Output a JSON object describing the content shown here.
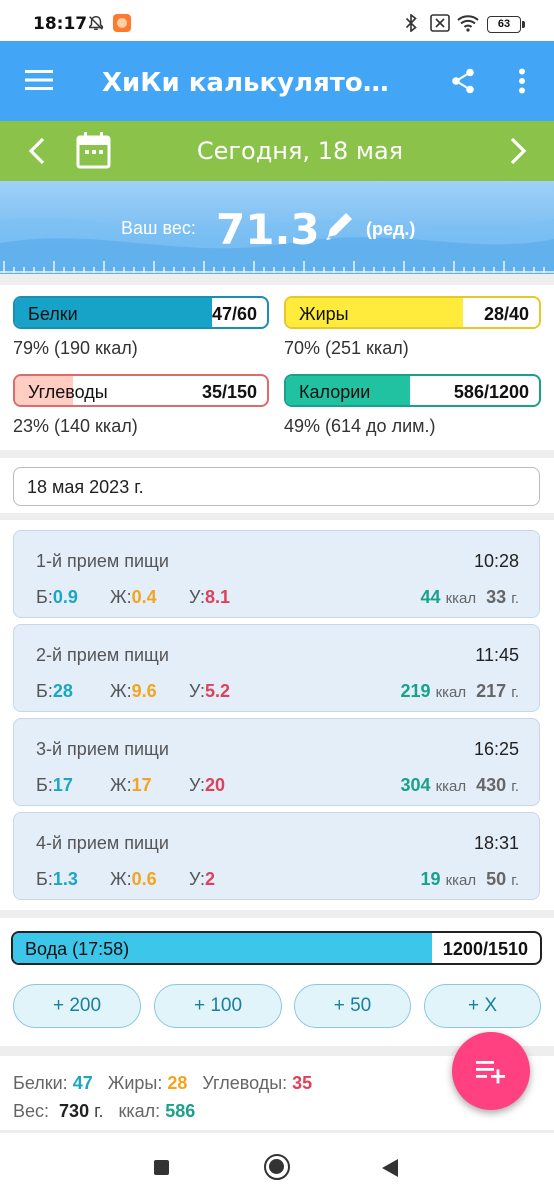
{
  "status_bar": {
    "time": "18:17",
    "battery": "63",
    "icons": [
      "notifications-off-icon",
      "app-notification-icon",
      "bluetooth-icon",
      "sim-off-icon",
      "wifi-icon",
      "battery-icon"
    ]
  },
  "app_bar": {
    "title": "ХиКи калькулятор калорий",
    "icons": [
      "menu-icon",
      "share-icon",
      "more-vert-icon"
    ]
  },
  "date_nav": {
    "date": "Сегодня, 18 мая",
    "icons": [
      "chevron-left-icon",
      "calendar-icon",
      "chevron-right-icon"
    ]
  },
  "weight": {
    "label": "Ваш вес:",
    "value": "71.3",
    "edit_label": "(ред.)",
    "icon": "pencil-icon"
  },
  "macros": {
    "protein": {
      "label": "Белки",
      "value": "47/60",
      "fraction": 0.78,
      "note": "79% (190 ккал)",
      "color": "#17a3c8"
    },
    "fat": {
      "label": "Жиры",
      "value": "28/40",
      "fraction": 0.7,
      "note": "70% (251 ккал)",
      "color": "#ffeb3b"
    },
    "carbs": {
      "label": "Углеводы",
      "value": "35/150",
      "fraction": 0.23,
      "note": "23% (140 ккал)",
      "color": "#ffcdc2"
    },
    "calories": {
      "label": "Калории",
      "value": "586/1200",
      "fraction": 0.49,
      "note": "49% (614 до лим.)",
      "color": "#20c2a2"
    }
  },
  "diary_date": "18 мая 2023 г.",
  "meals": [
    {
      "name": "1-й прием пищи",
      "time": "10:28",
      "b_label": "Б:",
      "b": "0.9",
      "z_label": "Ж:",
      "z": "0.4",
      "u_label": "У:",
      "u": "8.1",
      "kcal": "44",
      "kcal_unit": "ккал",
      "grams": "33",
      "grams_unit": "г."
    },
    {
      "name": "2-й прием пищи",
      "time": "11:45",
      "b_label": "Б:",
      "b": "28",
      "z_label": "Ж:",
      "z": "9.6",
      "u_label": "У:",
      "u": "5.2",
      "kcal": "219",
      "kcal_unit": "ккал",
      "grams": "217",
      "grams_unit": "г."
    },
    {
      "name": "3-й прием пищи",
      "time": "16:25",
      "b_label": "Б:",
      "b": "17",
      "z_label": "Ж:",
      "z": "17",
      "u_label": "У:",
      "u": "20",
      "kcal": "304",
      "kcal_unit": "ккал",
      "grams": "430",
      "grams_unit": "г."
    },
    {
      "name": "4-й прием пищи",
      "time": "18:31",
      "b_label": "Б:",
      "b": "1.3",
      "z_label": "Ж:",
      "z": "0.6",
      "u_label": "У:",
      "u": "2",
      "kcal": "19",
      "kcal_unit": "ккал",
      "grams": "50",
      "grams_unit": "г."
    }
  ],
  "water": {
    "label": "Вода (17:58)",
    "value": "1200/1510",
    "fraction": 0.795,
    "buttons": [
      "+ 200",
      "+ 100",
      "+ 50",
      "+ X"
    ]
  },
  "totals": {
    "protein_label": "Белки:",
    "protein": "47",
    "fat_label": "Жиры:",
    "fat": "28",
    "carbs_label": "Углеводы:",
    "carbs": "35",
    "weight_label": "Вес:",
    "weight": "730",
    "weight_unit": "г.",
    "kcal_label": "ккал:",
    "kcal": "586"
  },
  "fab": {
    "icon": "playlist-add-icon"
  },
  "nav_bar": {
    "icons": [
      "recents-square-icon",
      "home-circle-icon",
      "back-triangle-icon"
    ]
  }
}
